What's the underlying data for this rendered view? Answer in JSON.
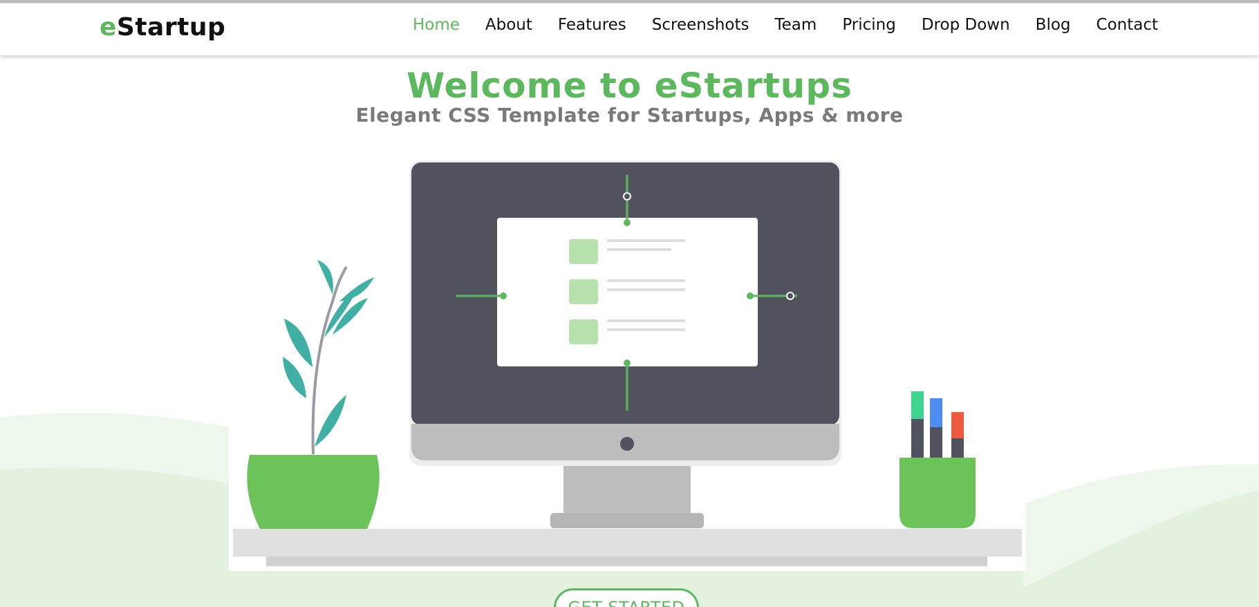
{
  "brand": {
    "prefix": "e",
    "name": "Startup"
  },
  "nav": {
    "items": [
      {
        "label": "Home",
        "active": true
      },
      {
        "label": "About"
      },
      {
        "label": "Features"
      },
      {
        "label": "Screenshots"
      },
      {
        "label": "Team"
      },
      {
        "label": "Pricing"
      },
      {
        "label": "Drop Down"
      },
      {
        "label": "Blog"
      },
      {
        "label": "Contact"
      }
    ]
  },
  "hero": {
    "title": "Welcome to eStartups",
    "subtitle": "Elegant CSS Template for Startups, Apps & more",
    "cta_label": "GET STARTED"
  },
  "colors": {
    "accent": "#5cb85c",
    "subtitle": "#7a7a7a",
    "monitor": "#52525f",
    "plant_leaf": "#3fb0a3",
    "pot": "#6cc35a"
  },
  "icons": [
    "monitor-illustration",
    "plant-icon",
    "pen-cup-icon"
  ]
}
